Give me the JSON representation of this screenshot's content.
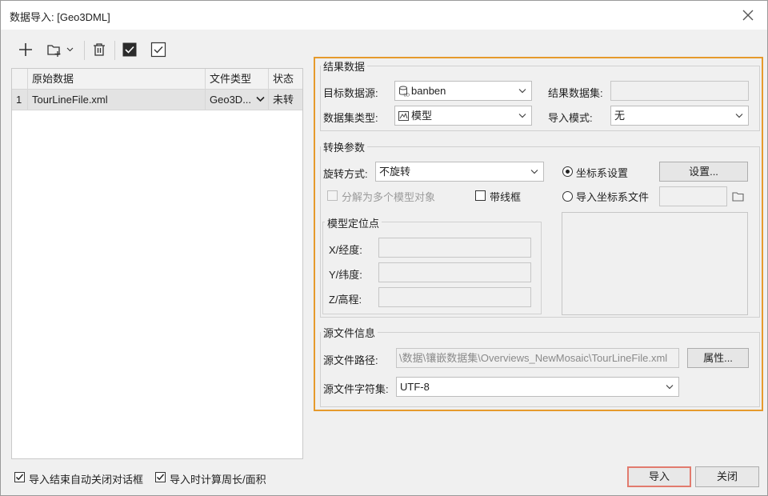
{
  "window": {
    "title": "数据导入: [Geo3DML]"
  },
  "toolbar": {
    "icons": [
      "add-icon",
      "add-folder-icon",
      "dropdown-arrow-icon",
      "delete-icon",
      "select-all-checked-icon",
      "select-invert-icon"
    ]
  },
  "grid": {
    "columns": [
      "原始数据",
      "文件类型",
      "状态"
    ],
    "rows": [
      {
        "index": "1",
        "source": "TourLineFile.xml",
        "type": "Geo3D...",
        "status": "未转"
      }
    ]
  },
  "result": {
    "group_label": "结果数据",
    "target_source_label": "目标数据源:",
    "target_source_value": "banben",
    "dataset_label": "结果数据集:",
    "dataset_value": "",
    "dataset_type_label": "数据集类型:",
    "dataset_type_value": "模型",
    "import_mode_label": "导入模式:",
    "import_mode_value": "无"
  },
  "convert": {
    "group_label": "转换参数",
    "rotate_label": "旋转方式:",
    "rotate_value": "不旋转",
    "split_label": "分解为多个模型对象",
    "split_checked": false,
    "wireframe_label": "带线框",
    "wireframe_checked": false,
    "coord_setting_label": "坐标系设置",
    "coord_setting_selected": true,
    "settings_button": "设置...",
    "import_coord_file_label": "导入坐标系文件",
    "import_coord_file_selected": false,
    "anchor_group_label": "模型定位点",
    "x_label": "X/经度:",
    "y_label": "Y/纬度:",
    "z_label": "Z/高程:"
  },
  "source_info": {
    "group_label": "源文件信息",
    "path_label": "源文件路径:",
    "path_value": "\\数据\\镶嵌数据集\\Overviews_NewMosaic\\TourLineFile.xml",
    "properties_button": "属性...",
    "charset_label": "源文件字符集:",
    "charset_value": "UTF-8"
  },
  "footer": {
    "auto_close_label": "导入结束自动关闭对话框",
    "auto_close_checked": true,
    "calc_label": "导入时计算周长/面积",
    "calc_checked": true,
    "import_button": "导入",
    "close_button": "关闭"
  },
  "colors": {
    "panel_border": "#e69a2c",
    "primary_border": "#e27b6e"
  }
}
